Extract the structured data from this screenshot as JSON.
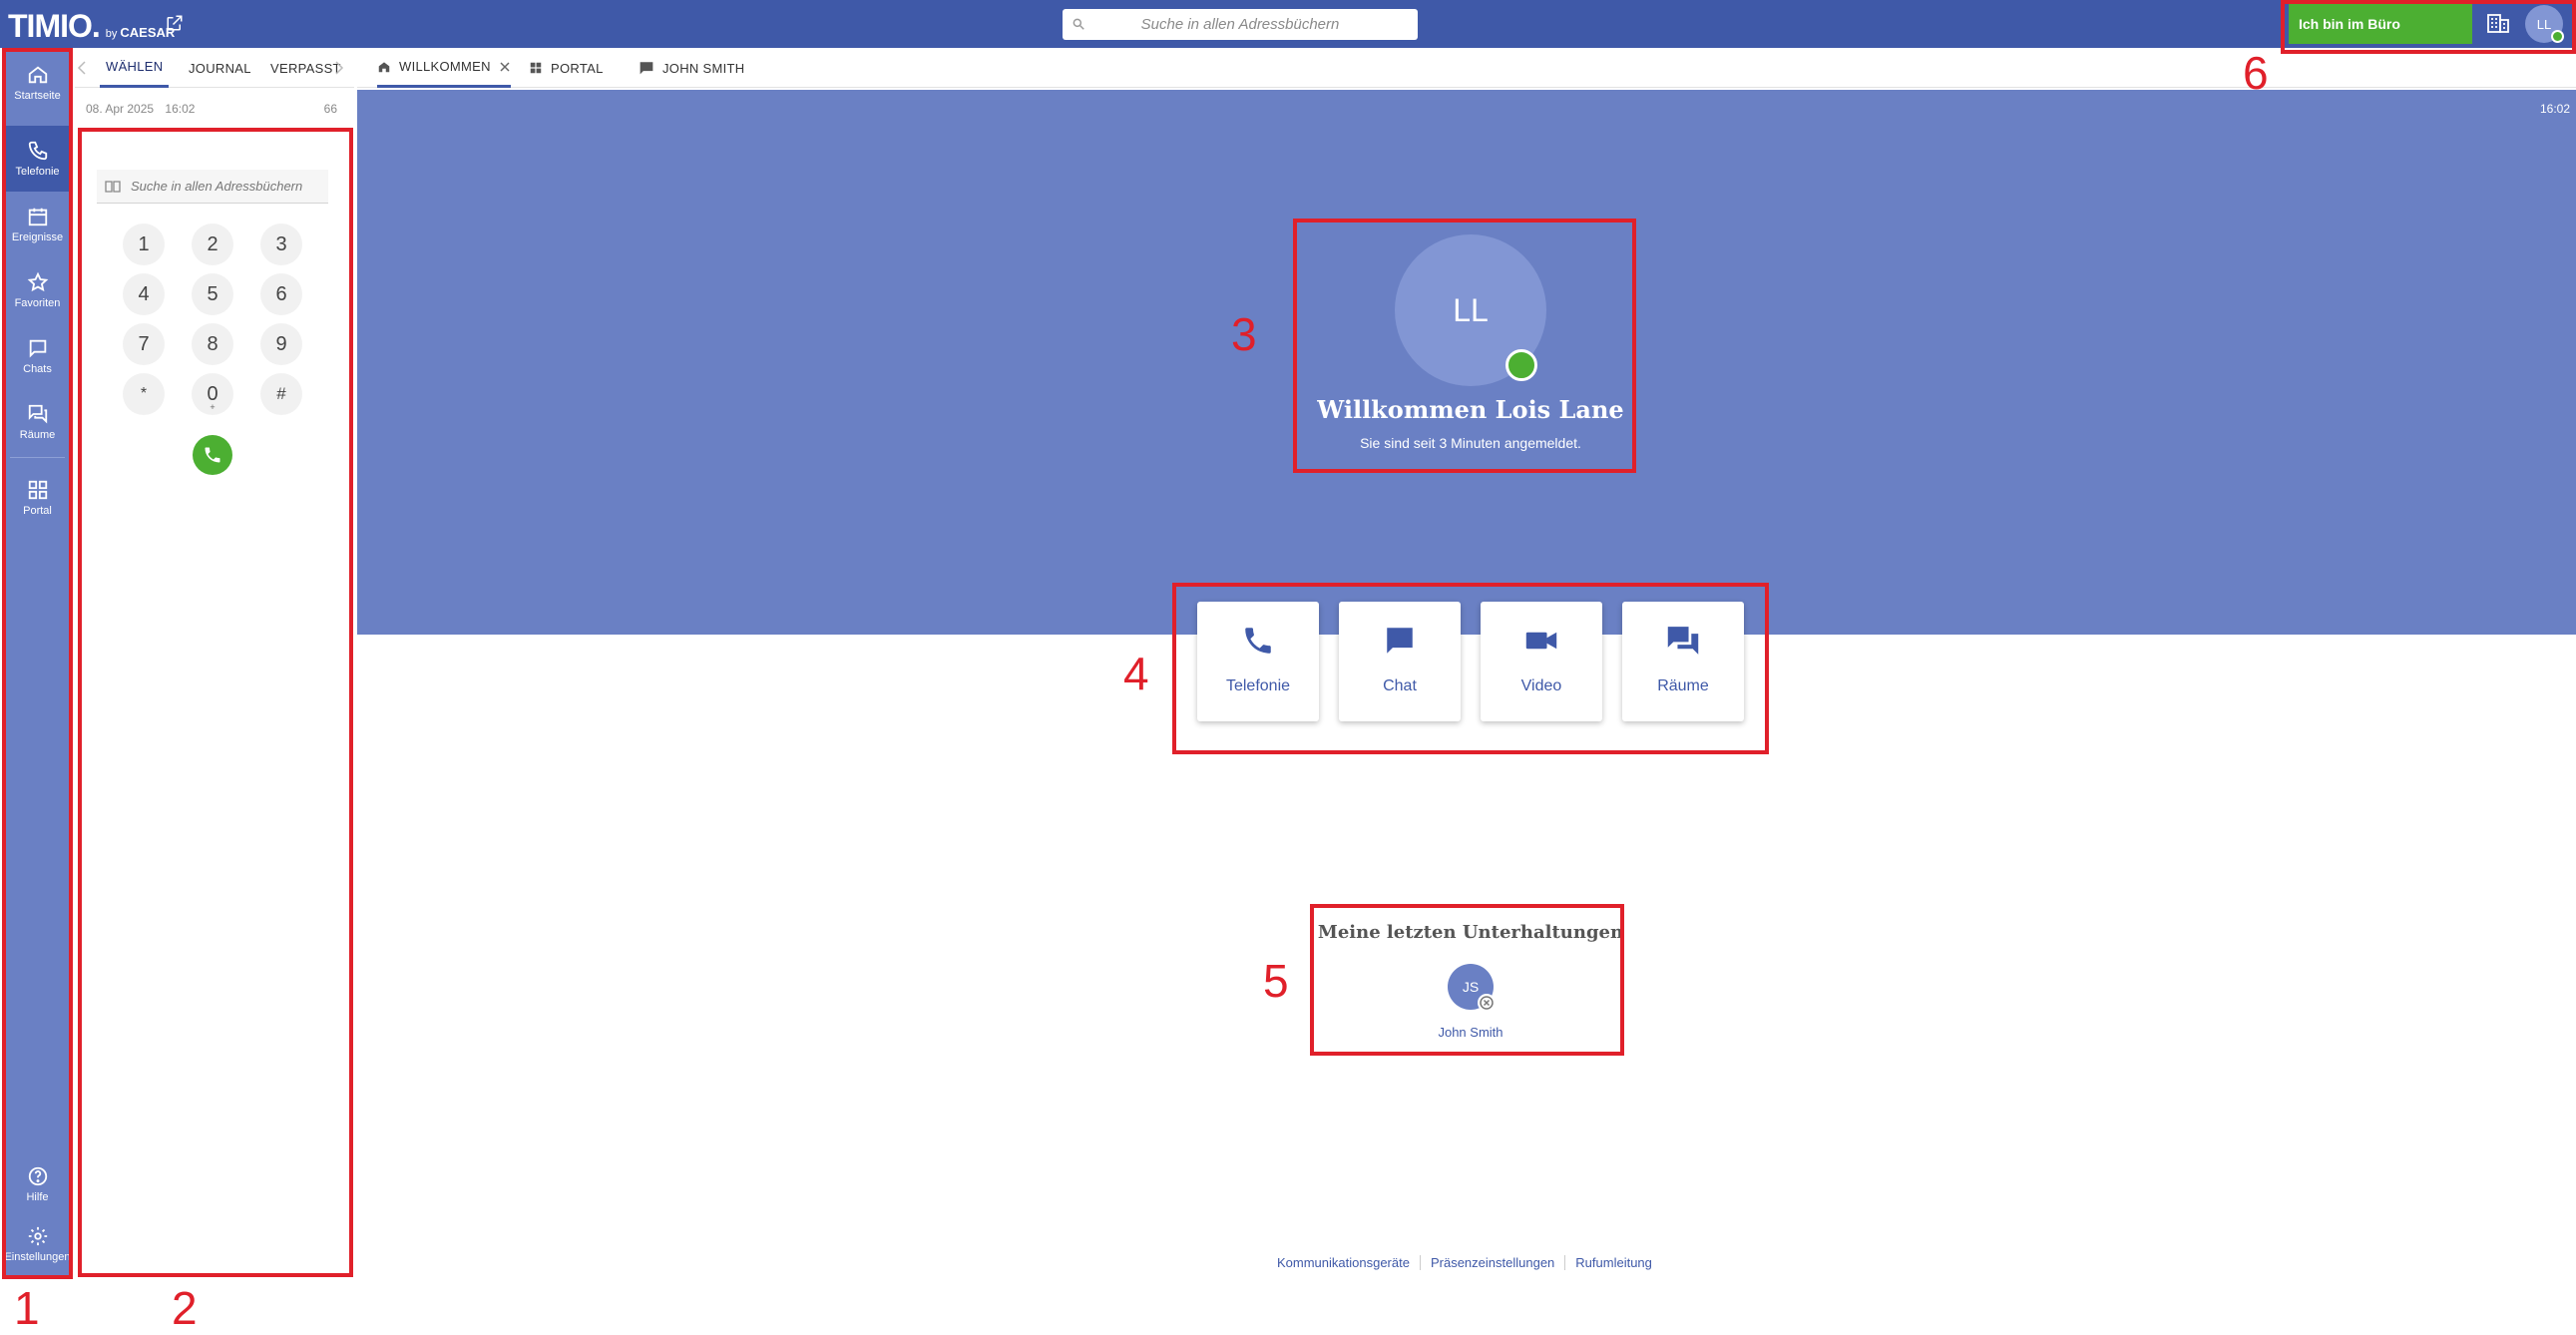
{
  "colors": {
    "brand_blue": "#3f59a8",
    "panel_blue": "#6a80c4",
    "avatar_blue": "#8296d4",
    "presence_green": "#4caf32",
    "annotation_red": "#e0202a"
  },
  "topbar": {
    "logo": "TIMIO.",
    "by": "by",
    "caesar": "CAESAR",
    "search_placeholder": "Suche in allen Adressbüchern",
    "presence_label": "Ich bin im Büro",
    "avatar_initials": "LL"
  },
  "sidebar": {
    "items": [
      {
        "label": "Startseite",
        "icon": "home-icon"
      },
      {
        "label": "Telefonie",
        "icon": "phone-icon"
      },
      {
        "label": "Ereignisse",
        "icon": "calendar-icon"
      },
      {
        "label": "Favoriten",
        "icon": "star-icon"
      },
      {
        "label": "Chats",
        "icon": "chat-icon"
      },
      {
        "label": "Räume",
        "icon": "rooms-icon"
      },
      {
        "label": "Portal",
        "icon": "grid-icon"
      }
    ],
    "bottom": [
      {
        "label": "Hilfe",
        "icon": "help-icon"
      },
      {
        "label": "Einstellungen",
        "icon": "gear-icon"
      }
    ]
  },
  "dialer": {
    "tabs": [
      "WÄHLEN",
      "JOURNAL",
      "VERPASST"
    ],
    "date": "08. Apr 2025",
    "time": "16:02",
    "count": "66",
    "search_placeholder": "Suche in allen Adressbüchern",
    "keys": [
      "1",
      "2",
      "3",
      "4",
      "5",
      "6",
      "7",
      "8",
      "9",
      "*",
      "0",
      "#"
    ],
    "zero_sub": "+"
  },
  "main_tabs": [
    {
      "label": "WILLKOMMEN",
      "icon": "home-icon"
    },
    {
      "label": "PORTAL",
      "icon": "grid-icon"
    },
    {
      "label": "JOHN SMITH",
      "icon": "chat-icon"
    }
  ],
  "hero": {
    "time": "16:02",
    "avatar_initials": "LL",
    "title": "Willkommen Lois Lane",
    "subtitle": "Sie sind seit 3 Minuten angemeldet."
  },
  "actions": [
    {
      "label": "Telefonie",
      "icon": "phone-icon"
    },
    {
      "label": "Chat",
      "icon": "chat-icon"
    },
    {
      "label": "Video",
      "icon": "video-icon"
    },
    {
      "label": "Räume",
      "icon": "rooms-icon"
    }
  ],
  "recent": {
    "title": "Meine letzten Unterhaltungen",
    "contact_initials": "JS",
    "contact_name": "John Smith"
  },
  "footer": {
    "links": [
      "Kommunikationsgeräte",
      "Präsenzeinstellungen",
      "Rufumleitung"
    ]
  },
  "annotations": [
    "1",
    "2",
    "3",
    "4",
    "5",
    "6"
  ]
}
